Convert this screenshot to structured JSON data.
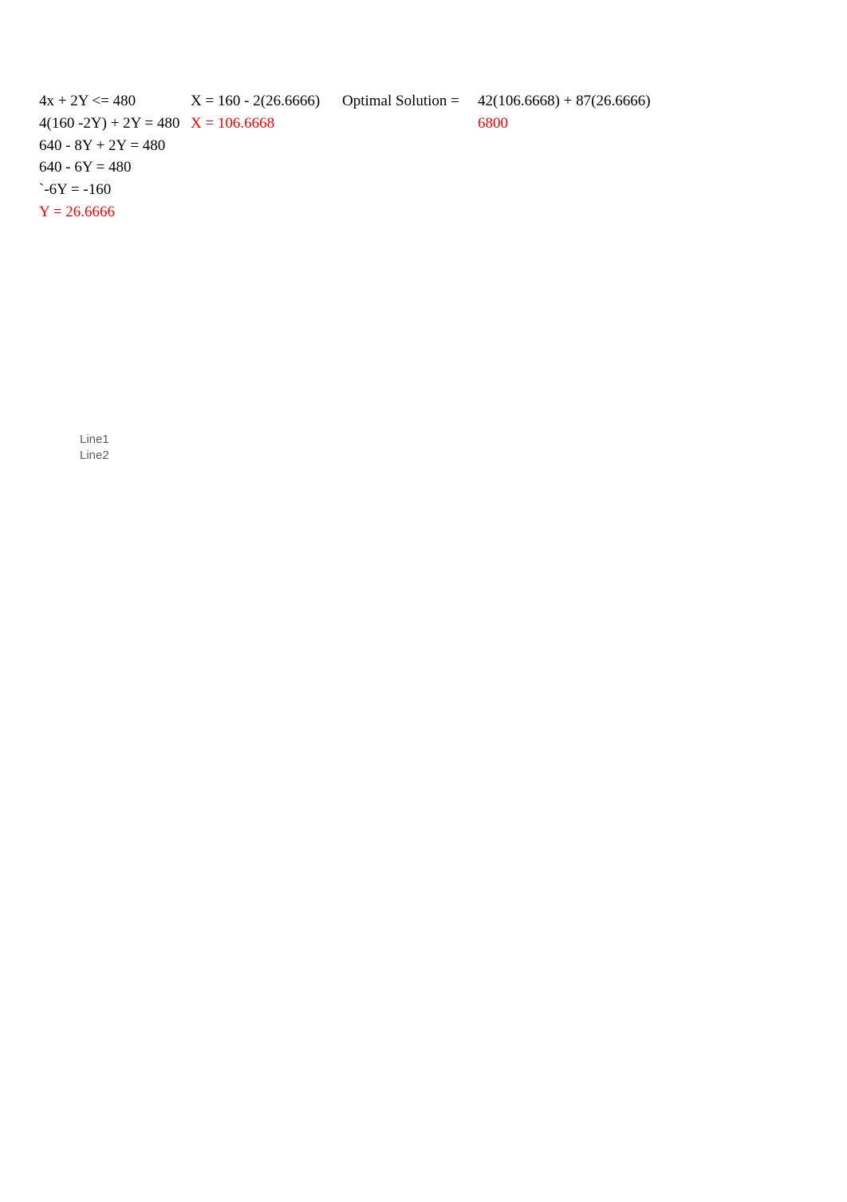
{
  "equations": {
    "col1": {
      "line1": "4x + 2Y <= 480",
      "line2": "4(160 -2Y) + 2Y = 480",
      "line3": "640 - 8Y + 2Y = 480",
      "line4": "640 - 6Y = 480",
      "line5": "`-6Y = -160",
      "line6": "Y = 26.6666"
    },
    "col2": {
      "line1": "X = 160 - 2(26.6666)",
      "line2": "X = 106.6668"
    },
    "col3": {
      "line1": "Optimal Solution ="
    },
    "col4": {
      "line1": "42(106.6668) + 87(26.6666)",
      "line2": "6800"
    }
  },
  "legend": {
    "item1": "Line1",
    "item2": "Line2"
  }
}
